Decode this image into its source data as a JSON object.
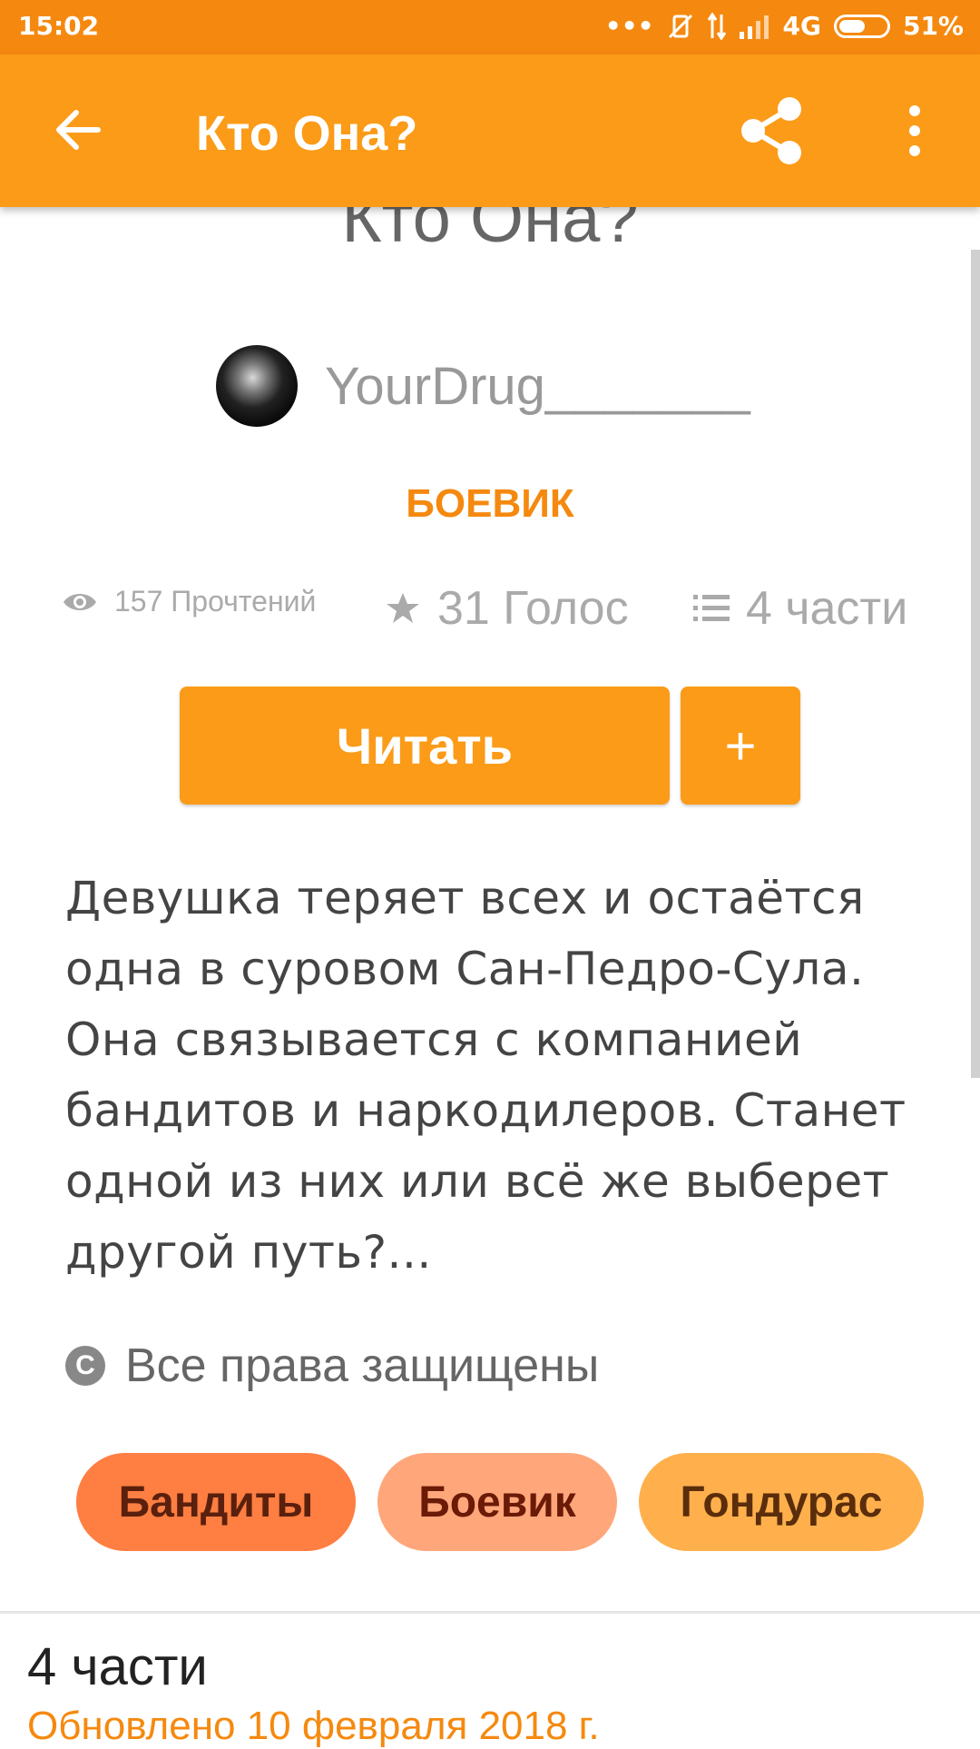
{
  "status_bar": {
    "time": "15:02",
    "network": "4G",
    "battery": "51%"
  },
  "app_bar": {
    "title": "Кто Она?"
  },
  "story": {
    "title": "Кто Она?",
    "author": "YourDrug_______",
    "genre": "БОЕВИК",
    "stats": {
      "reads": "157 Прочтений",
      "votes": "31 Голос",
      "parts": "4 части"
    },
    "read_button": "Читать",
    "add_button": "+",
    "description": "Девушка теряет всех и остаётся одна в суровом Сан-Педро-Сула. Она связывается с компанией бандитов и наркодилеров. Станет одной из них или всё же выберет другой путь?...",
    "copyright_symbol": "C",
    "copyright": "Все права защищены",
    "tags": [
      "Бандиты",
      "Боевик",
      "Гондурас"
    ]
  },
  "parts_section": {
    "heading": "4 части",
    "updated": "Обновлено 10 февраля 2018 г."
  },
  "colors": {
    "primary": "#fb9b18",
    "status_bar": "#f5890f",
    "tag_1": "#ff7e42",
    "tag_2": "#ffa67b",
    "tag_3": "#ffb04c"
  },
  "icons": {
    "back": "arrow-left-icon",
    "share": "share-icon",
    "more": "more-vertical-icon",
    "reads": "eye-icon",
    "votes": "star-icon",
    "parts": "list-icon",
    "copyright": "copyright-icon"
  }
}
